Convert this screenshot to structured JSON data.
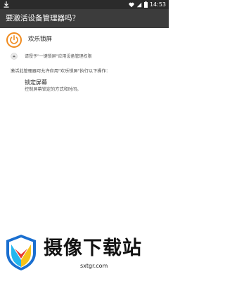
{
  "status_bar": {
    "time": "14:53",
    "left_icon": "download-icon",
    "right_icons": [
      "heart-icon",
      "signal-icon",
      "battery-icon"
    ]
  },
  "app_bar": {
    "title": "要激活设备管理器吗？"
  },
  "app": {
    "name": "欢乐锁屏",
    "icon": "power-icon",
    "icon_color": "#f08a1c"
  },
  "request": {
    "text": "请授予\"一键锁屏\"应用设备管理权限",
    "icon": "expand-up-icon"
  },
  "permissions": {
    "intro": "激活此管理器可允许应用\"欢乐锁屏\"执行以下操作：",
    "items": [
      {
        "title": "锁定屏幕",
        "description": "控制屏幕锁定的方式和时间。"
      }
    ]
  },
  "watermark": {
    "text": "摄像下载站",
    "url": "sxtgr.com"
  }
}
